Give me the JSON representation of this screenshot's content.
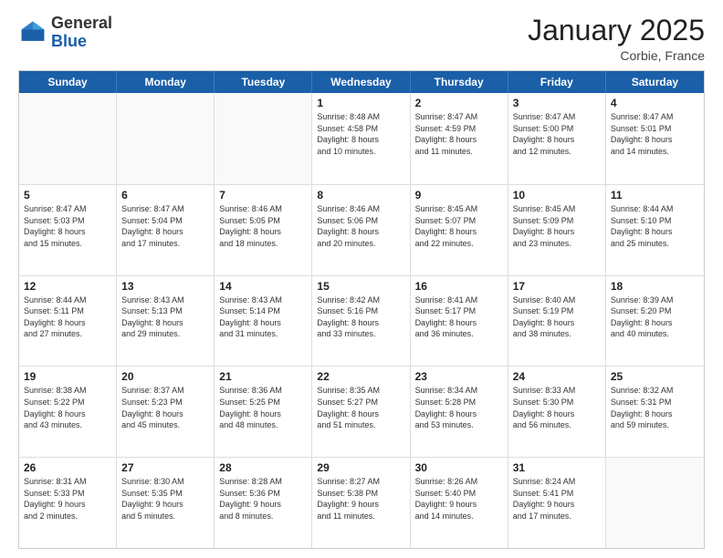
{
  "logo": {
    "general": "General",
    "blue": "Blue"
  },
  "title": "January 2025",
  "subtitle": "Corbie, France",
  "days": [
    "Sunday",
    "Monday",
    "Tuesday",
    "Wednesday",
    "Thursday",
    "Friday",
    "Saturday"
  ],
  "weeks": [
    [
      {
        "day": "",
        "content": ""
      },
      {
        "day": "",
        "content": ""
      },
      {
        "day": "",
        "content": ""
      },
      {
        "day": "1",
        "content": "Sunrise: 8:48 AM\nSunset: 4:58 PM\nDaylight: 8 hours\nand 10 minutes."
      },
      {
        "day": "2",
        "content": "Sunrise: 8:47 AM\nSunset: 4:59 PM\nDaylight: 8 hours\nand 11 minutes."
      },
      {
        "day": "3",
        "content": "Sunrise: 8:47 AM\nSunset: 5:00 PM\nDaylight: 8 hours\nand 12 minutes."
      },
      {
        "day": "4",
        "content": "Sunrise: 8:47 AM\nSunset: 5:01 PM\nDaylight: 8 hours\nand 14 minutes."
      }
    ],
    [
      {
        "day": "5",
        "content": "Sunrise: 8:47 AM\nSunset: 5:03 PM\nDaylight: 8 hours\nand 15 minutes."
      },
      {
        "day": "6",
        "content": "Sunrise: 8:47 AM\nSunset: 5:04 PM\nDaylight: 8 hours\nand 17 minutes."
      },
      {
        "day": "7",
        "content": "Sunrise: 8:46 AM\nSunset: 5:05 PM\nDaylight: 8 hours\nand 18 minutes."
      },
      {
        "day": "8",
        "content": "Sunrise: 8:46 AM\nSunset: 5:06 PM\nDaylight: 8 hours\nand 20 minutes."
      },
      {
        "day": "9",
        "content": "Sunrise: 8:45 AM\nSunset: 5:07 PM\nDaylight: 8 hours\nand 22 minutes."
      },
      {
        "day": "10",
        "content": "Sunrise: 8:45 AM\nSunset: 5:09 PM\nDaylight: 8 hours\nand 23 minutes."
      },
      {
        "day": "11",
        "content": "Sunrise: 8:44 AM\nSunset: 5:10 PM\nDaylight: 8 hours\nand 25 minutes."
      }
    ],
    [
      {
        "day": "12",
        "content": "Sunrise: 8:44 AM\nSunset: 5:11 PM\nDaylight: 8 hours\nand 27 minutes."
      },
      {
        "day": "13",
        "content": "Sunrise: 8:43 AM\nSunset: 5:13 PM\nDaylight: 8 hours\nand 29 minutes."
      },
      {
        "day": "14",
        "content": "Sunrise: 8:43 AM\nSunset: 5:14 PM\nDaylight: 8 hours\nand 31 minutes."
      },
      {
        "day": "15",
        "content": "Sunrise: 8:42 AM\nSunset: 5:16 PM\nDaylight: 8 hours\nand 33 minutes."
      },
      {
        "day": "16",
        "content": "Sunrise: 8:41 AM\nSunset: 5:17 PM\nDaylight: 8 hours\nand 36 minutes."
      },
      {
        "day": "17",
        "content": "Sunrise: 8:40 AM\nSunset: 5:19 PM\nDaylight: 8 hours\nand 38 minutes."
      },
      {
        "day": "18",
        "content": "Sunrise: 8:39 AM\nSunset: 5:20 PM\nDaylight: 8 hours\nand 40 minutes."
      }
    ],
    [
      {
        "day": "19",
        "content": "Sunrise: 8:38 AM\nSunset: 5:22 PM\nDaylight: 8 hours\nand 43 minutes."
      },
      {
        "day": "20",
        "content": "Sunrise: 8:37 AM\nSunset: 5:23 PM\nDaylight: 8 hours\nand 45 minutes."
      },
      {
        "day": "21",
        "content": "Sunrise: 8:36 AM\nSunset: 5:25 PM\nDaylight: 8 hours\nand 48 minutes."
      },
      {
        "day": "22",
        "content": "Sunrise: 8:35 AM\nSunset: 5:27 PM\nDaylight: 8 hours\nand 51 minutes."
      },
      {
        "day": "23",
        "content": "Sunrise: 8:34 AM\nSunset: 5:28 PM\nDaylight: 8 hours\nand 53 minutes."
      },
      {
        "day": "24",
        "content": "Sunrise: 8:33 AM\nSunset: 5:30 PM\nDaylight: 8 hours\nand 56 minutes."
      },
      {
        "day": "25",
        "content": "Sunrise: 8:32 AM\nSunset: 5:31 PM\nDaylight: 8 hours\nand 59 minutes."
      }
    ],
    [
      {
        "day": "26",
        "content": "Sunrise: 8:31 AM\nSunset: 5:33 PM\nDaylight: 9 hours\nand 2 minutes."
      },
      {
        "day": "27",
        "content": "Sunrise: 8:30 AM\nSunset: 5:35 PM\nDaylight: 9 hours\nand 5 minutes."
      },
      {
        "day": "28",
        "content": "Sunrise: 8:28 AM\nSunset: 5:36 PM\nDaylight: 9 hours\nand 8 minutes."
      },
      {
        "day": "29",
        "content": "Sunrise: 8:27 AM\nSunset: 5:38 PM\nDaylight: 9 hours\nand 11 minutes."
      },
      {
        "day": "30",
        "content": "Sunrise: 8:26 AM\nSunset: 5:40 PM\nDaylight: 9 hours\nand 14 minutes."
      },
      {
        "day": "31",
        "content": "Sunrise: 8:24 AM\nSunset: 5:41 PM\nDaylight: 9 hours\nand 17 minutes."
      },
      {
        "day": "",
        "content": ""
      }
    ]
  ]
}
